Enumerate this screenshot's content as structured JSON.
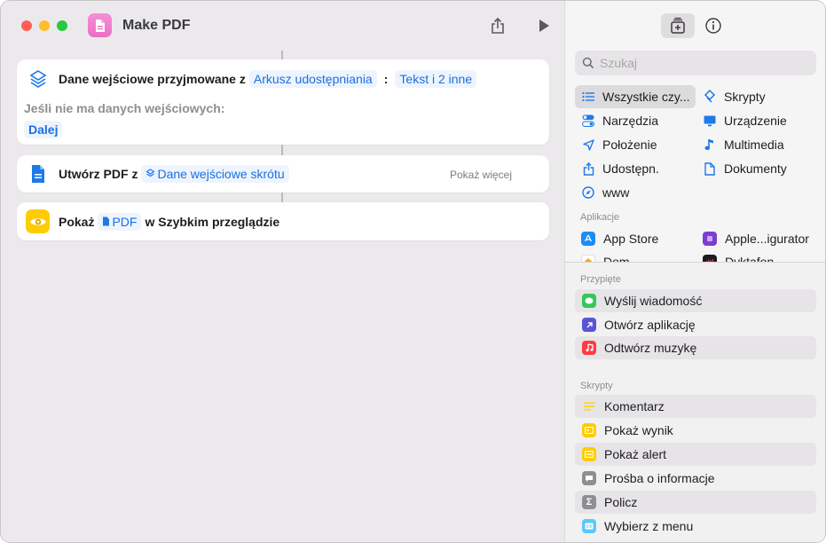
{
  "window": {
    "title": "Make PDF"
  },
  "workflow": {
    "input_card": {
      "prefix": "Dane wejściowe przyjmowane z",
      "source_token": "Arkusz udostępniania",
      "colon": ":",
      "types_token": "Tekst i 2 inne",
      "no_input_label": "Jeśli nie ma danych wejściowych:",
      "no_input_action": "Dalej"
    },
    "pdf_card": {
      "prefix": "Utwórz PDF z",
      "input_token": "Dane wejściowe skrótu",
      "show_more": "Pokaż więcej"
    },
    "quicklook_card": {
      "prefix": "Pokaż",
      "token": "PDF",
      "suffix": "w Szybkim przeglądzie"
    }
  },
  "sidebar": {
    "search_placeholder": "Szukaj",
    "categories": [
      {
        "label": "Wszystkie czy...",
        "icon": "list-icon",
        "selected": true
      },
      {
        "label": "Skrypty",
        "icon": "scripts-icon"
      },
      {
        "label": "Narzędzia",
        "icon": "toggle-icon"
      },
      {
        "label": "Urządzenie",
        "icon": "monitor-icon"
      },
      {
        "label": "Położenie",
        "icon": "location-arrow-icon"
      },
      {
        "label": "Multimedia",
        "icon": "music-note-icon"
      },
      {
        "label": "Udostępn.",
        "icon": "share-icon"
      },
      {
        "label": "Dokumenty",
        "icon": "document-icon"
      },
      {
        "label": "www",
        "icon": "compass-icon"
      }
    ],
    "apps_label": "Aplikacje",
    "apps": [
      {
        "label": "App Store",
        "icon": "app-store-icon",
        "color": "#1e8cf3"
      },
      {
        "label": "Apple...igurator",
        "icon": "configurator-icon",
        "color": "#7a3fd0"
      },
      {
        "label": "Dom",
        "icon": "home-icon",
        "color": "#f5a623"
      },
      {
        "label": "Dyktafon",
        "icon": "voice-memos-icon",
        "color": "#1c1c1e"
      }
    ],
    "pinned_label": "Przypięte",
    "pinned": [
      {
        "label": "Wyślij wiadomość",
        "icon": "messages-icon",
        "color": "#34c759"
      },
      {
        "label": "Otwórz aplikację",
        "icon": "open-app-icon",
        "color": "#5856d6"
      },
      {
        "label": "Odtwórz muzykę",
        "icon": "music-icon",
        "color": "#fc3c44"
      }
    ],
    "scripts_label": "Skrypty",
    "scripts": [
      {
        "label": "Komentarz",
        "icon": "comment-icon",
        "color": "#ffd60a"
      },
      {
        "label": "Pokaż wynik",
        "icon": "show-result-icon",
        "color": "#ffcc00"
      },
      {
        "label": "Pokaż alert",
        "icon": "alert-icon",
        "color": "#ffcc00"
      },
      {
        "label": "Prośba o informacje",
        "icon": "ask-input-icon",
        "color": "#8e8e93"
      },
      {
        "label": "Policz",
        "icon": "sigma-icon",
        "color": "#8e8e93"
      },
      {
        "label": "Wybierz z menu",
        "icon": "menu-icon",
        "color": "#5ac8fa"
      }
    ]
  }
}
